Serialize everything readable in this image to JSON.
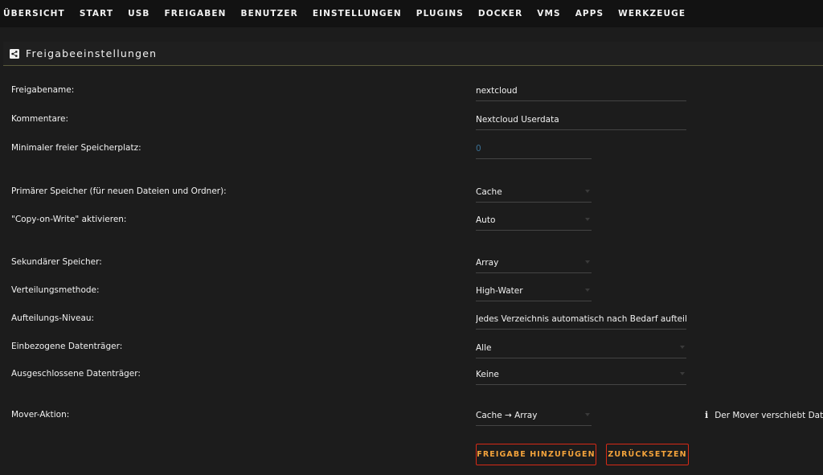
{
  "nav": {
    "items": [
      "ÜBERSICHT",
      "START",
      "USB",
      "FREIGABEN",
      "BENUTZER",
      "EINSTELLUNGEN",
      "PLUGINS",
      "DOCKER",
      "VMS",
      "APPS",
      "WERKZEUGE"
    ]
  },
  "panel": {
    "title": "Freigabeeinstellungen",
    "icon": "share-icon"
  },
  "form": {
    "share_name": {
      "label": "Freigabename:",
      "value": "nextcloud"
    },
    "comment": {
      "label": "Kommentare:",
      "value": "Nextcloud Userdata"
    },
    "min_free": {
      "label": "Minimaler freier Speicherplatz:",
      "placeholder": "0"
    },
    "primary_storage": {
      "label": "Primärer Speicher (für neuen Dateien und Ordner):",
      "value": "Cache"
    },
    "cow": {
      "label": "\"Copy-on-Write\" aktivieren:",
      "value": "Auto"
    },
    "secondary_storage": {
      "label": "Sekundärer Speicher:",
      "value": "Array"
    },
    "allocation": {
      "label": "Verteilungsmethode:",
      "value": "High-Water"
    },
    "split_level": {
      "label": "Aufteilungs-Niveau:",
      "value": "Jedes Verzeichnis automatisch nach Bedarf aufteilen"
    },
    "included_disks": {
      "label": "Einbezogene Datenträger:",
      "value": "Alle"
    },
    "excluded_disks": {
      "label": "Ausgeschlossene Datenträger:",
      "value": "Keine"
    },
    "mover_action": {
      "label": "Mover-Aktion:",
      "value": "Cache → Array"
    }
  },
  "info": {
    "icon": "info-icon",
    "text": "Der Mover verschiebt Date"
  },
  "buttons": {
    "add": "FREIGABE HINZUFÜGEN",
    "reset": "ZURÜCKSETZEN"
  },
  "colors": {
    "background": "#1c1c1c",
    "nav_background": "#121212",
    "button_border": "#d62a16",
    "button_text": "#f3a33b",
    "placeholder": "#3a6f93"
  }
}
